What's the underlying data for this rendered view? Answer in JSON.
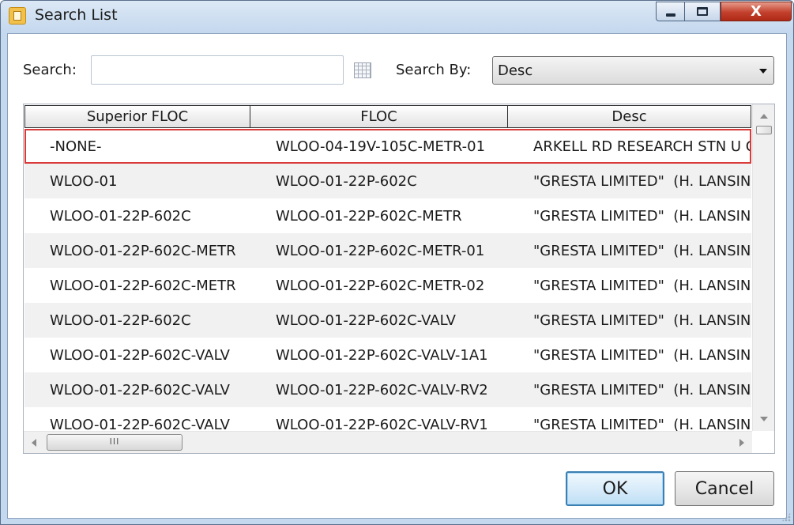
{
  "window": {
    "title": "Search List",
    "min_icon": "minimize-icon",
    "max_icon": "maximize-icon",
    "close_icon": "close-icon",
    "close_glyph": "X"
  },
  "search": {
    "label": "Search:",
    "value": "",
    "placeholder": ""
  },
  "search_by": {
    "label": "Search By:",
    "selected": "Desc"
  },
  "table": {
    "columns": [
      "Superior FLOC",
      "FLOC",
      "Desc"
    ],
    "rows": [
      [
        "-NONE-",
        "WLOO-04-19V-105C-METR-01",
        "ARKELL RD RESEARCH STN U C"
      ],
      [
        "WLOO-01",
        "WLOO-01-22P-602C",
        "\"GRESTA LIMITED\"  (H. LANSIN"
      ],
      [
        "WLOO-01-22P-602C",
        "WLOO-01-22P-602C-METR",
        "\"GRESTA LIMITED\"  (H. LANSIN"
      ],
      [
        "WLOO-01-22P-602C-METR",
        "WLOO-01-22P-602C-METR-01",
        "\"GRESTA LIMITED\"  (H. LANSIN"
      ],
      [
        "WLOO-01-22P-602C-METR",
        "WLOO-01-22P-602C-METR-02",
        "\"GRESTA LIMITED\"  (H. LANSIN"
      ],
      [
        "WLOO-01-22P-602C",
        "WLOO-01-22P-602C-VALV",
        "\"GRESTA LIMITED\"  (H. LANSIN"
      ],
      [
        "WLOO-01-22P-602C-VALV",
        "WLOO-01-22P-602C-VALV-1A1",
        "\"GRESTA LIMITED\"  (H. LANSIN"
      ],
      [
        "WLOO-01-22P-602C-VALV",
        "WLOO-01-22P-602C-VALV-RV2",
        "\"GRESTA LIMITED\"  (H. LANSIN"
      ],
      [
        "WLOO-01-22P-602C-VALV",
        "WLOO-01-22P-602C-VALV-RV1",
        "\"GRESTA LIMITED\"  (H. LANSIN"
      ]
    ],
    "selected_row": 0,
    "hscroll_thumb_glyph": "III"
  },
  "buttons": {
    "ok": "OK",
    "cancel": "Cancel"
  },
  "colors": {
    "selection_outline": "#d93a3a",
    "ok_border": "#3c7fb1",
    "close_button": "#c2402c"
  }
}
